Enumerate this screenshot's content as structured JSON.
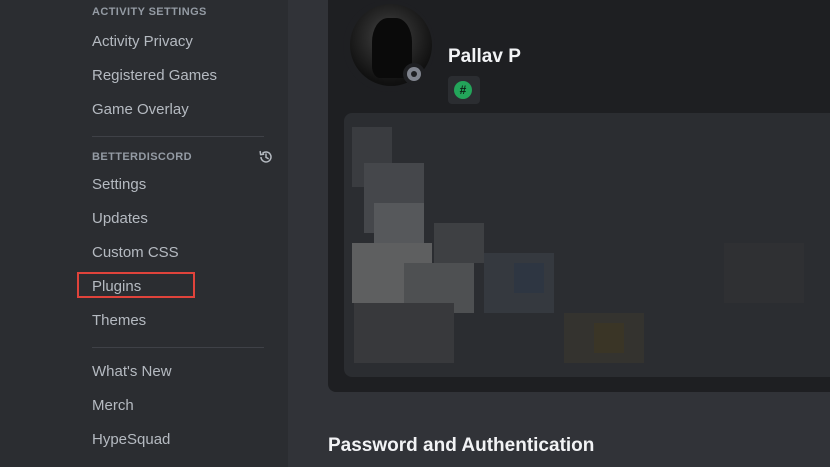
{
  "sidebar": {
    "activity_settings": {
      "header": "ACTIVITY SETTINGS",
      "items": [
        {
          "label": "Activity Privacy"
        },
        {
          "label": "Registered Games"
        },
        {
          "label": "Game Overlay"
        }
      ]
    },
    "betterdiscord": {
      "header": "BETTERDISCORD",
      "history_icon": "history-icon",
      "items": [
        {
          "label": "Settings"
        },
        {
          "label": "Updates"
        },
        {
          "label": "Custom CSS"
        },
        {
          "label": "Plugins",
          "highlighted": true
        },
        {
          "label": "Themes"
        }
      ]
    },
    "misc": {
      "items": [
        {
          "label": "What's New"
        },
        {
          "label": "Merch"
        },
        {
          "label": "HypeSquad"
        }
      ]
    }
  },
  "profile": {
    "username": "Pallav P",
    "status": "offline",
    "badge_symbol": "#",
    "badge_color": "#23a55a"
  },
  "main": {
    "section_title": "Password and Authentication"
  },
  "colors": {
    "sidebar_bg": "#2b2d31",
    "main_bg": "#313338",
    "card_bg": "#1e1f22",
    "highlight": "#e0433b",
    "text_muted": "#b5bac1"
  }
}
